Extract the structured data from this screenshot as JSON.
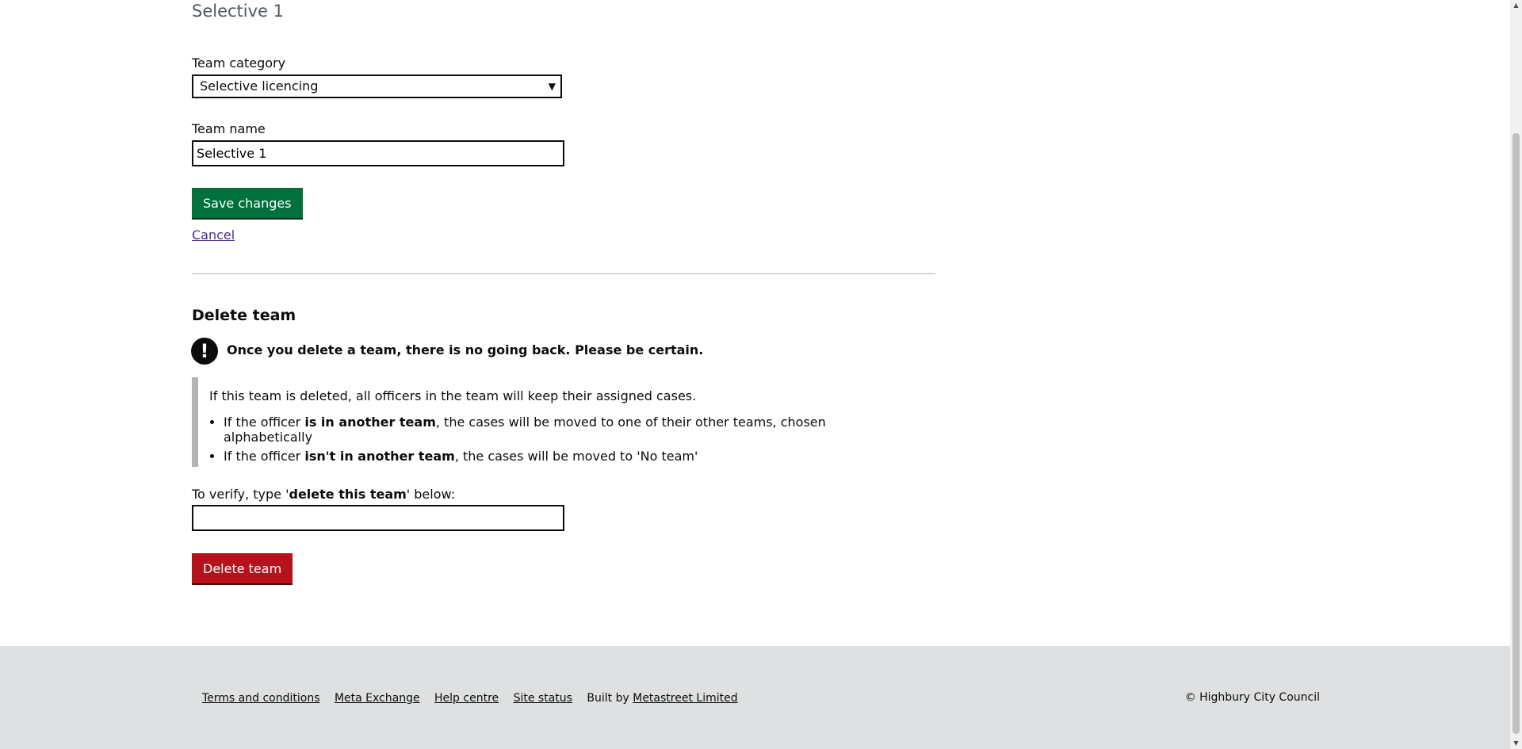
{
  "page": {
    "caption": "Selective 1"
  },
  "form": {
    "category_label": "Team category",
    "category_value": "Selective licencing",
    "name_label": "Team name",
    "name_value": "Selective 1",
    "save_label": "Save changes",
    "cancel_label": "Cancel"
  },
  "delete_section": {
    "heading": "Delete team",
    "warning_icon": "!",
    "warning": "Once you delete a team, there is no going back. Please be certain.",
    "inset_text": "If this team is deleted, all officers in the team will keep their assigned cases.",
    "bullets": [
      {
        "pre": "If the officer ",
        "bold": "is in another team",
        "post": ", the cases will be moved to one of their other teams, chosen alphabetically"
      },
      {
        "pre": "If the officer ",
        "bold": "isn't in another team",
        "post": ", the cases will be moved to 'No team'"
      }
    ],
    "verify_pre": "To verify, type '",
    "verify_bold": "delete this team",
    "verify_post": "' below:",
    "verify_value": "",
    "delete_label": "Delete team"
  },
  "footer": {
    "links": [
      "Terms and conditions",
      "Meta Exchange",
      "Help centre",
      "Site status"
    ],
    "built_by_prefix": "Built by ",
    "built_by_link": "Metastreet Limited",
    "copyright": "© Highbury City Council"
  },
  "colors": {
    "save_button": "#00703c",
    "delete_button": "#b5121b",
    "link_visited": "#4c2c92",
    "footer_bg": "#dfe0e1"
  }
}
